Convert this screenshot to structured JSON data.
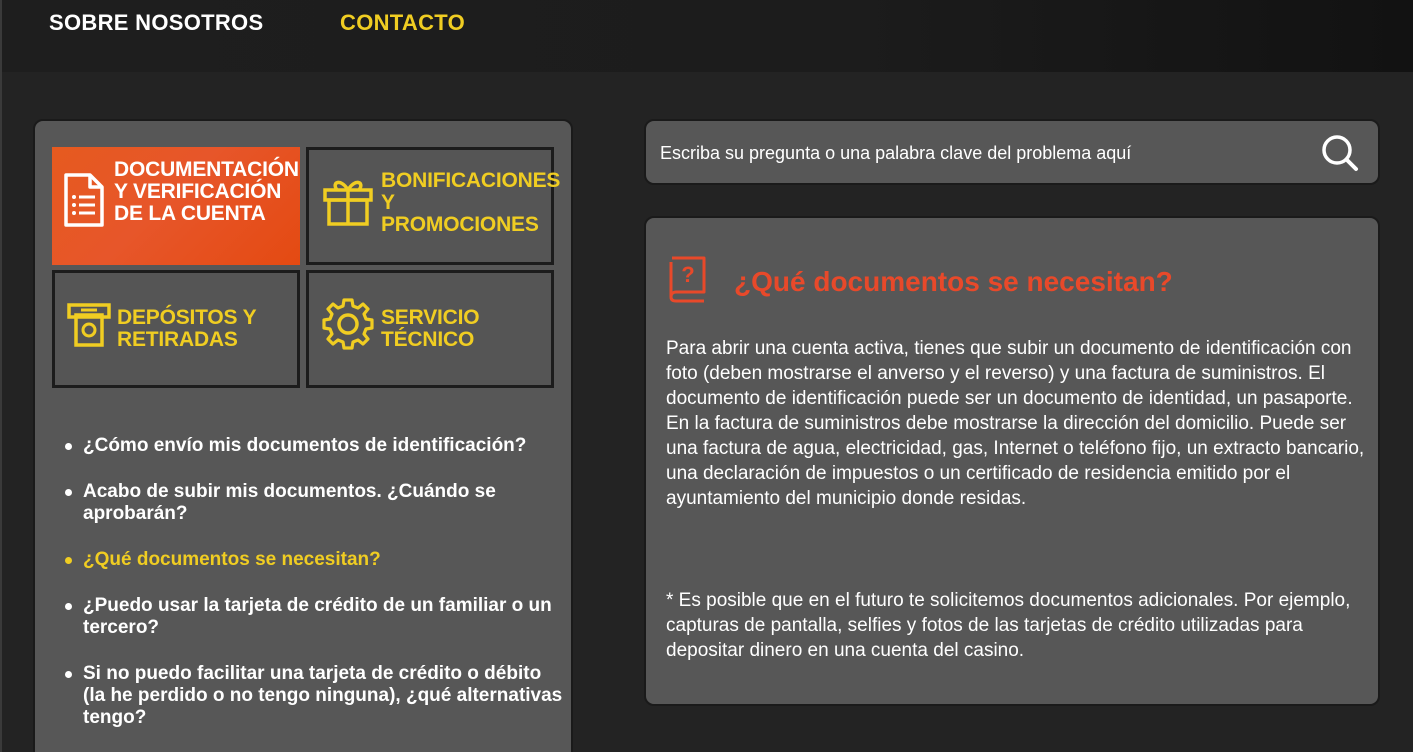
{
  "nav": {
    "about": "SOBRE NOSOTROS",
    "contact": "CONTACTO"
  },
  "categories": [
    {
      "label": "DOCUMENTACIÓN Y VERIFICACIÓN DE LA CUENTA",
      "icon": "document-list-icon",
      "active": true
    },
    {
      "label": "BONIFICACIONES Y PROMOCIONES",
      "icon": "gift-icon",
      "active": false
    },
    {
      "label": "DEPÓSITOS Y RETIRADAS",
      "icon": "atm-cash-icon",
      "active": false
    },
    {
      "label": "SERVICIO TÉCNICO",
      "icon": "gear-icon",
      "active": false
    }
  ],
  "faq": [
    {
      "text": "¿Cómo envío mis documentos de identificación?"
    },
    {
      "text": "Acabo de subir mis documentos. ¿Cuándo se aprobarán?"
    },
    {
      "text": "¿Qué documentos se necesitan?",
      "active": true
    },
    {
      "text": "¿Puedo usar la tarjeta de crédito de un familiar o un tercero?"
    },
    {
      "text": "Si no puedo facilitar una tarjeta de crédito o débito (la he perdido o no tengo ninguna), ¿qué alternativas tengo?"
    }
  ],
  "search": {
    "placeholder": "Escriba su pregunta o una palabra clave del problema aquí",
    "icon": "search-icon"
  },
  "article": {
    "icon": "book-question-icon",
    "title": "¿Qué documentos se necesitan?",
    "body": "Para abrir una cuenta activa, tienes que subir un documento de identificación con foto (deben mostrarse el anverso y el reverso) y una factura de suministros. El documento de identificación puede ser un documento de identidad, un pasaporte. En la factura de suministros debe mostrarse la dirección del domicilio. Puede ser una factura de agua, electricidad, gas, Internet o teléfono fijo, un extracto bancario, una declaración de impuestos o un certificado de residencia emitido por el ayuntamiento del municipio donde residas.",
    "note": "* Es posible que en el futuro te solicitemos documentos adicionales. Por ejemplo, capturas de pantalla, selfies y fotos de las tarjetas de crédito utilizadas para depositar dinero en una cuenta del casino."
  },
  "colors": {
    "accent_yellow": "#f0cd22",
    "accent_orange": "#e65a1f",
    "title_red": "#e8492a",
    "panel_gray": "#575757",
    "background": "#232323"
  }
}
